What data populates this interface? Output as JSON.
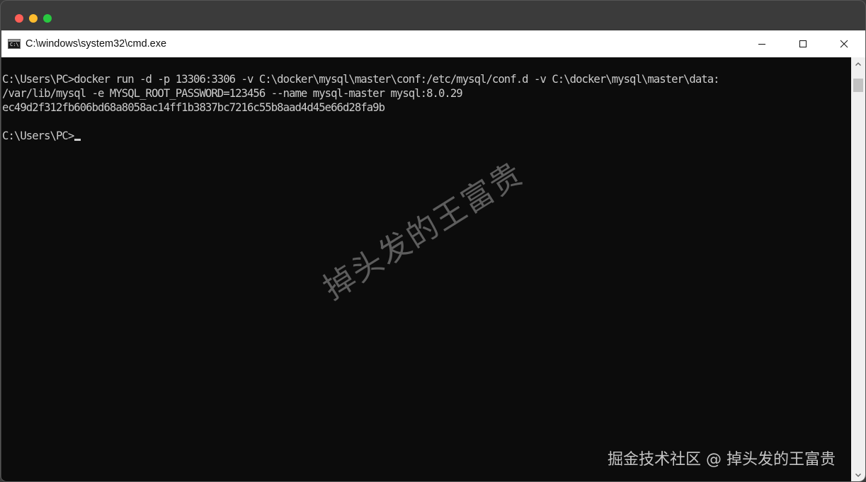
{
  "window": {
    "title": "C:\\windows\\system32\\cmd.exe",
    "icon": "cmd-console-icon",
    "icon_label": "C:\\"
  },
  "controls": {
    "minimize_icon": "minimize-icon",
    "maximize_icon": "maximize-icon",
    "close_icon": "close-icon"
  },
  "console": {
    "lines": [
      "C:\\Users\\PC>docker run -d -p 13306:3306 -v C:\\docker\\mysql\\master\\conf:/etc/mysql/conf.d -v C:\\docker\\mysql\\master\\data:",
      "/var/lib/mysql -e MYSQL_ROOT_PASSWORD=123456 --name mysql-master mysql:8.0.29",
      "ec49d2f312fb606bd68a8058ac14ff1b3837bc7216c55b8aad4d45e66d28fa9b"
    ],
    "prompt": "C:\\Users\\PC>",
    "text_color": "#cccccc",
    "background": "#0c0c0c"
  },
  "watermark": {
    "text": "掉头发的王富贵"
  },
  "corner_mark": {
    "text": "掘金技术社区 @ 掉头发的王富贵"
  }
}
